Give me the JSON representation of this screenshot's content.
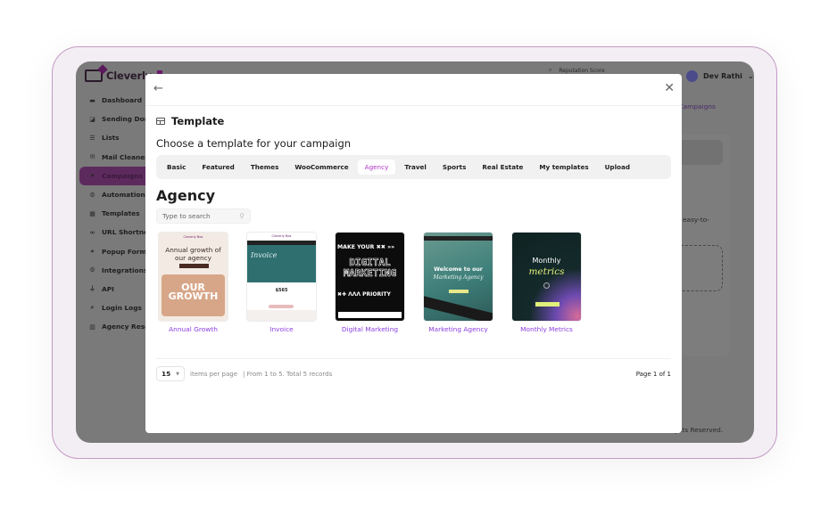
{
  "app": {
    "brand": "Cleverly",
    "sidebar": {
      "items": [
        {
          "label": "Dashboard",
          "icon": "dashboard-icon",
          "glyph": "▬"
        },
        {
          "label": "Sending Dom",
          "icon": "domain-icon",
          "glyph": "◪"
        },
        {
          "label": "Lists",
          "icon": "list-icon",
          "glyph": "☰"
        },
        {
          "label": "Mail Cleaner",
          "icon": "mail-icon",
          "glyph": "✉"
        },
        {
          "label": "Campaigns",
          "icon": "send-icon",
          "glyph": "➤",
          "active": true
        },
        {
          "label": "Automations",
          "icon": "gear-icon",
          "glyph": "⚙"
        },
        {
          "label": "Templates",
          "icon": "templates-icon",
          "glyph": "▦"
        },
        {
          "label": "URL Shortner",
          "icon": "link-icon",
          "glyph": "∞"
        },
        {
          "label": "Popup Forms",
          "icon": "popup-icon",
          "glyph": "⌖"
        },
        {
          "label": "Integrations",
          "icon": "integrations-icon",
          "glyph": "⚙"
        },
        {
          "label": "API",
          "icon": "plug-icon",
          "glyph": "⏚"
        },
        {
          "label": "Login Logs",
          "icon": "search-log-icon",
          "glyph": "⌕"
        },
        {
          "label": "Agency Resel",
          "icon": "agency-icon",
          "glyph": "▥"
        }
      ]
    },
    "topbar": {
      "search_label": "Reputation Score",
      "user_name": "Dev Rathi"
    },
    "breadcrumb_tail": "e > Campaigns",
    "bg_text": "easy-to-",
    "footer": "ghts Reserved."
  },
  "modal": {
    "back_label": "←",
    "close_label": "✕",
    "title": "Template",
    "subtitle": "Choose a template for your campaign",
    "tabs": [
      {
        "label": "Basic"
      },
      {
        "label": "Featured"
      },
      {
        "label": "Themes"
      },
      {
        "label": "WooCommerce"
      },
      {
        "label": "Agency",
        "active": true
      },
      {
        "label": "Travel"
      },
      {
        "label": "Sports"
      },
      {
        "label": "Real Estate"
      },
      {
        "label": "My templates"
      },
      {
        "label": "Upload"
      }
    ],
    "section_title": "Agency",
    "search": {
      "placeholder": "Type to search",
      "value": ""
    },
    "templates": [
      {
        "name": "Annual Growth",
        "thumb": {
          "brand": "Cleverly Box",
          "headline": "Annual growth of our agency",
          "image_text": "OUR GROWTH"
        }
      },
      {
        "name": "Invoice",
        "thumb": {
          "brand": "Cleverly Box",
          "headline": "Invoice",
          "amount": "$565"
        }
      },
      {
        "name": "Digital Marketing",
        "thumb": {
          "line1": "MAKE YOUR ✖✖ »»",
          "line2": "DIGITAL MARKETING",
          "line3": "✖✚ ΛΛΛ PRIORITY"
        }
      },
      {
        "name": "Marketing Agency",
        "thumb": {
          "headline": "Welcome to our",
          "subhead": "Marketing Agency"
        }
      },
      {
        "name": "Monthly Metrics",
        "thumb": {
          "headline": "Monthly",
          "subhead": "metrics"
        }
      }
    ],
    "pagination": {
      "per_page": "15",
      "per_page_label": "items per page",
      "summary": "| From 1 to 5. Total 5 records",
      "page_info": "Page 1 of 1"
    }
  },
  "colors": {
    "accent": "#b033c6",
    "link": "#8b3de0",
    "frame_border": "#c49ac6"
  }
}
